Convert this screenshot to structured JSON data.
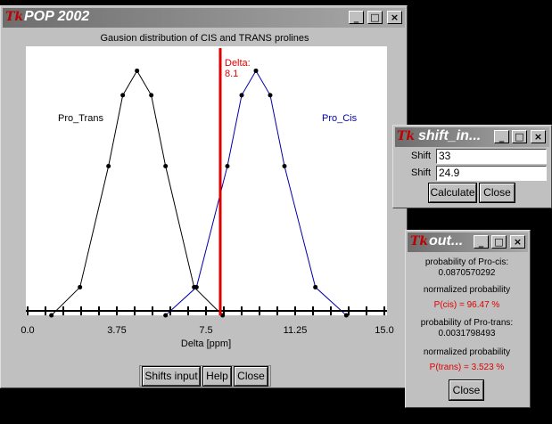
{
  "main_window": {
    "title": "POP 2002",
    "logo": "Tk",
    "buttons": {
      "shifts_input": "Shifts input",
      "help": "Help",
      "close": "Close"
    }
  },
  "chart_data": {
    "type": "line",
    "title": "Gausion distribution of CIS and TRANS prolines",
    "xlabel": "Delta [ppm]",
    "x_ticks": [
      "0.0",
      "3.75",
      "7.5",
      "11.25",
      "15.0"
    ],
    "xlim": [
      0,
      15
    ],
    "ylim": [
      0,
      1.1
    ],
    "series": [
      {
        "name": "Pro_Trans",
        "color": "#000000",
        "x": [
          1.0,
          2.2,
          3.4,
          4.0,
          4.6,
          5.2,
          5.8,
          7.0,
          8.2
        ],
        "y": [
          0.0,
          0.115,
          0.61,
          0.9,
          1.0,
          0.9,
          0.61,
          0.115,
          0.0
        ]
      },
      {
        "name": "Pro_Cis",
        "color": "#0000aa",
        "x": [
          5.8,
          7.1,
          8.4,
          9.0,
          9.6,
          10.2,
          10.8,
          12.1,
          13.4
        ],
        "y": [
          0.0,
          0.115,
          0.61,
          0.9,
          1.0,
          0.9,
          0.61,
          0.115,
          0.0
        ]
      }
    ],
    "annotations": {
      "delta_label": "Delta:",
      "delta_value": "8.1",
      "delta_x": 8.1,
      "delta_color": "#e00000"
    }
  },
  "shift_window": {
    "title": "shift_in...",
    "logo": "Tk",
    "fields": [
      {
        "label": "Shift",
        "value": "33"
      },
      {
        "label": "Shift",
        "value": "24.9"
      }
    ],
    "buttons": {
      "calculate": "Calculate",
      "close": "Close"
    }
  },
  "output_window": {
    "title": "out...",
    "logo": "Tk",
    "prob_cis_label": "probability of Pro-cis:",
    "prob_cis_value": "0.0870570292",
    "norm_label_1": "normalized probability",
    "p_cis": "P(cis) = 96.47 %",
    "prob_trans_label": "probability of Pro-trans:",
    "prob_trans_value": "0.0031798493",
    "norm_label_2": "normalized probability",
    "p_trans": "P(trans) = 3.523 %",
    "close": "Close"
  }
}
